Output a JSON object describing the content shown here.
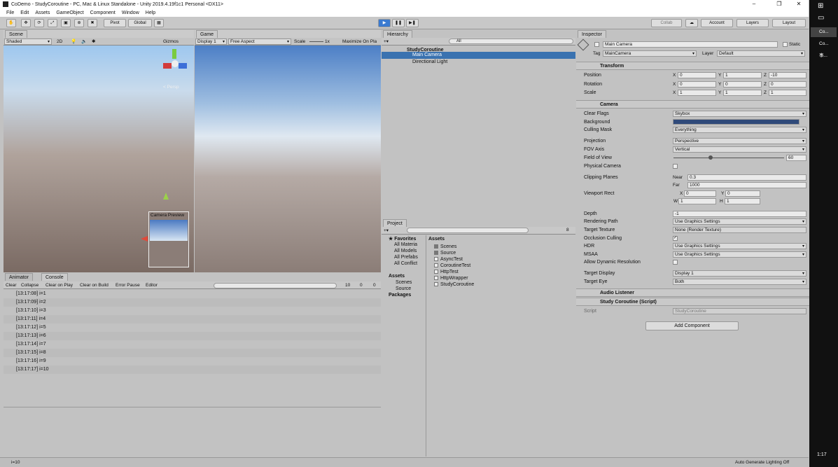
{
  "window": {
    "title": "CoDemo - StudyCoroutine - PC, Mac & Linux Standalone - Unity 2019.4.19f1c1 Personal <DX11>"
  },
  "menu": [
    "File",
    "Edit",
    "Assets",
    "GameObject",
    "Component",
    "Window",
    "Help"
  ],
  "toolbar": {
    "pivot": "Pivot",
    "global": "Global",
    "collab": "Collab",
    "account": "Account",
    "layers": "Layers",
    "layout": "Layout"
  },
  "scene": {
    "tab": "Scene",
    "shading": "Shaded",
    "mode2d": "2D",
    "gizmos": "Gizmos",
    "persp": "< Persp",
    "camera_preview": "Camera Preview"
  },
  "game": {
    "tab": "Game",
    "display": "Display 1",
    "aspect": "Free Aspect",
    "scale_label": "Scale",
    "scale_value": "1x",
    "maximize": "Maximize On Pla"
  },
  "hierarchy": {
    "tab": "Hierarchy",
    "search": "All",
    "scene": "StudyCoroutine",
    "items": [
      "Main Camera",
      "Directional Light"
    ]
  },
  "project": {
    "tab": "Project",
    "favorites": "Favorites",
    "fav_items": [
      "All Materia",
      "All Models",
      "All Prefabs",
      "All Conflict"
    ],
    "assets": "Assets",
    "asset_tree": [
      "Scenes",
      "Source"
    ],
    "packages": "Packages",
    "assets_header": "Assets",
    "files": [
      "Scenes",
      "Source",
      "AsyncTest",
      "CoroutineTest",
      "HttpTest",
      "HttpWrapper",
      "StudyCoroutine"
    ],
    "count": "8"
  },
  "console": {
    "tab_animator": "Animator",
    "tab": "Console",
    "buttons": [
      "Clear",
      "Collapse",
      "Clear on Play",
      "Clear on Build",
      "Error Pause",
      "Editor"
    ],
    "info_count": "10",
    "warn_count": "0",
    "err_count": "0",
    "logs": [
      "[13:17:08] i=1",
      "[13:17:09] i=2",
      "[13:17:10] i=3",
      "[13:17:11] i=4",
      "[13:17:12] i=5",
      "[13:17:13] i=6",
      "[13:17:14] i=7",
      "[13:17:15] i=8",
      "[13:17:16] i=9",
      "[13:17:17] i=10"
    ]
  },
  "inspector": {
    "tab": "Inspector",
    "object": "Main Camera",
    "static": "Static",
    "tag_label": "Tag",
    "tag": "MainCamera",
    "layer_label": "Layer",
    "layer": "Default",
    "transform": {
      "title": "Transform",
      "position": "Position",
      "rotation": "Rotation",
      "scale": "Scale",
      "pos": [
        "0",
        "1",
        "-10"
      ],
      "rot": [
        "0",
        "0",
        "0"
      ],
      "scl": [
        "1",
        "1",
        "1"
      ]
    },
    "camera": {
      "title": "Camera",
      "clear_flags": "Clear Flags",
      "clear_flags_v": "Skybox",
      "background": "Background",
      "background_color": "#2f4a7a",
      "culling_mask": "Culling Mask",
      "culling_mask_v": "Everything",
      "projection": "Projection",
      "projection_v": "Perspective",
      "fov_axis": "FOV Axis",
      "fov_axis_v": "Vertical",
      "fov": "Field of View",
      "fov_v": "60",
      "physical": "Physical Camera",
      "clipping": "Clipping Planes",
      "near": "Near",
      "near_v": "0.3",
      "far": "Far",
      "far_v": "1000",
      "viewport": "Viewport Rect",
      "vx": "0",
      "vy": "0",
      "vw": "1",
      "vh": "1",
      "depth": "Depth",
      "depth_v": "-1",
      "rendering_path": "Rendering Path",
      "rendering_path_v": "Use Graphics Settings",
      "target_texture": "Target Texture",
      "target_texture_v": "None (Render Texture)",
      "occlusion": "Occlusion Culling",
      "hdr": "HDR",
      "hdr_v": "Use Graphics Settings",
      "msaa": "MSAA",
      "msaa_v": "Use Graphics Settings",
      "dynres": "Allow Dynamic Resolution",
      "target_display": "Target Display",
      "target_display_v": "Display 1",
      "target_eye": "Target Eye",
      "target_eye_v": "Both"
    },
    "audio": {
      "title": "Audio Listener"
    },
    "script": {
      "title": "Study Coroutine (Script)",
      "label": "Script",
      "value": "StudyCoroutine"
    },
    "add_component": "Add Component"
  },
  "statusbar": {
    "left": "i=10",
    "right": "Auto Generate Lighting Off"
  },
  "taskbar": {
    "items": [
      "Co...",
      "Co...",
      "事..."
    ],
    "time": "1:17"
  }
}
